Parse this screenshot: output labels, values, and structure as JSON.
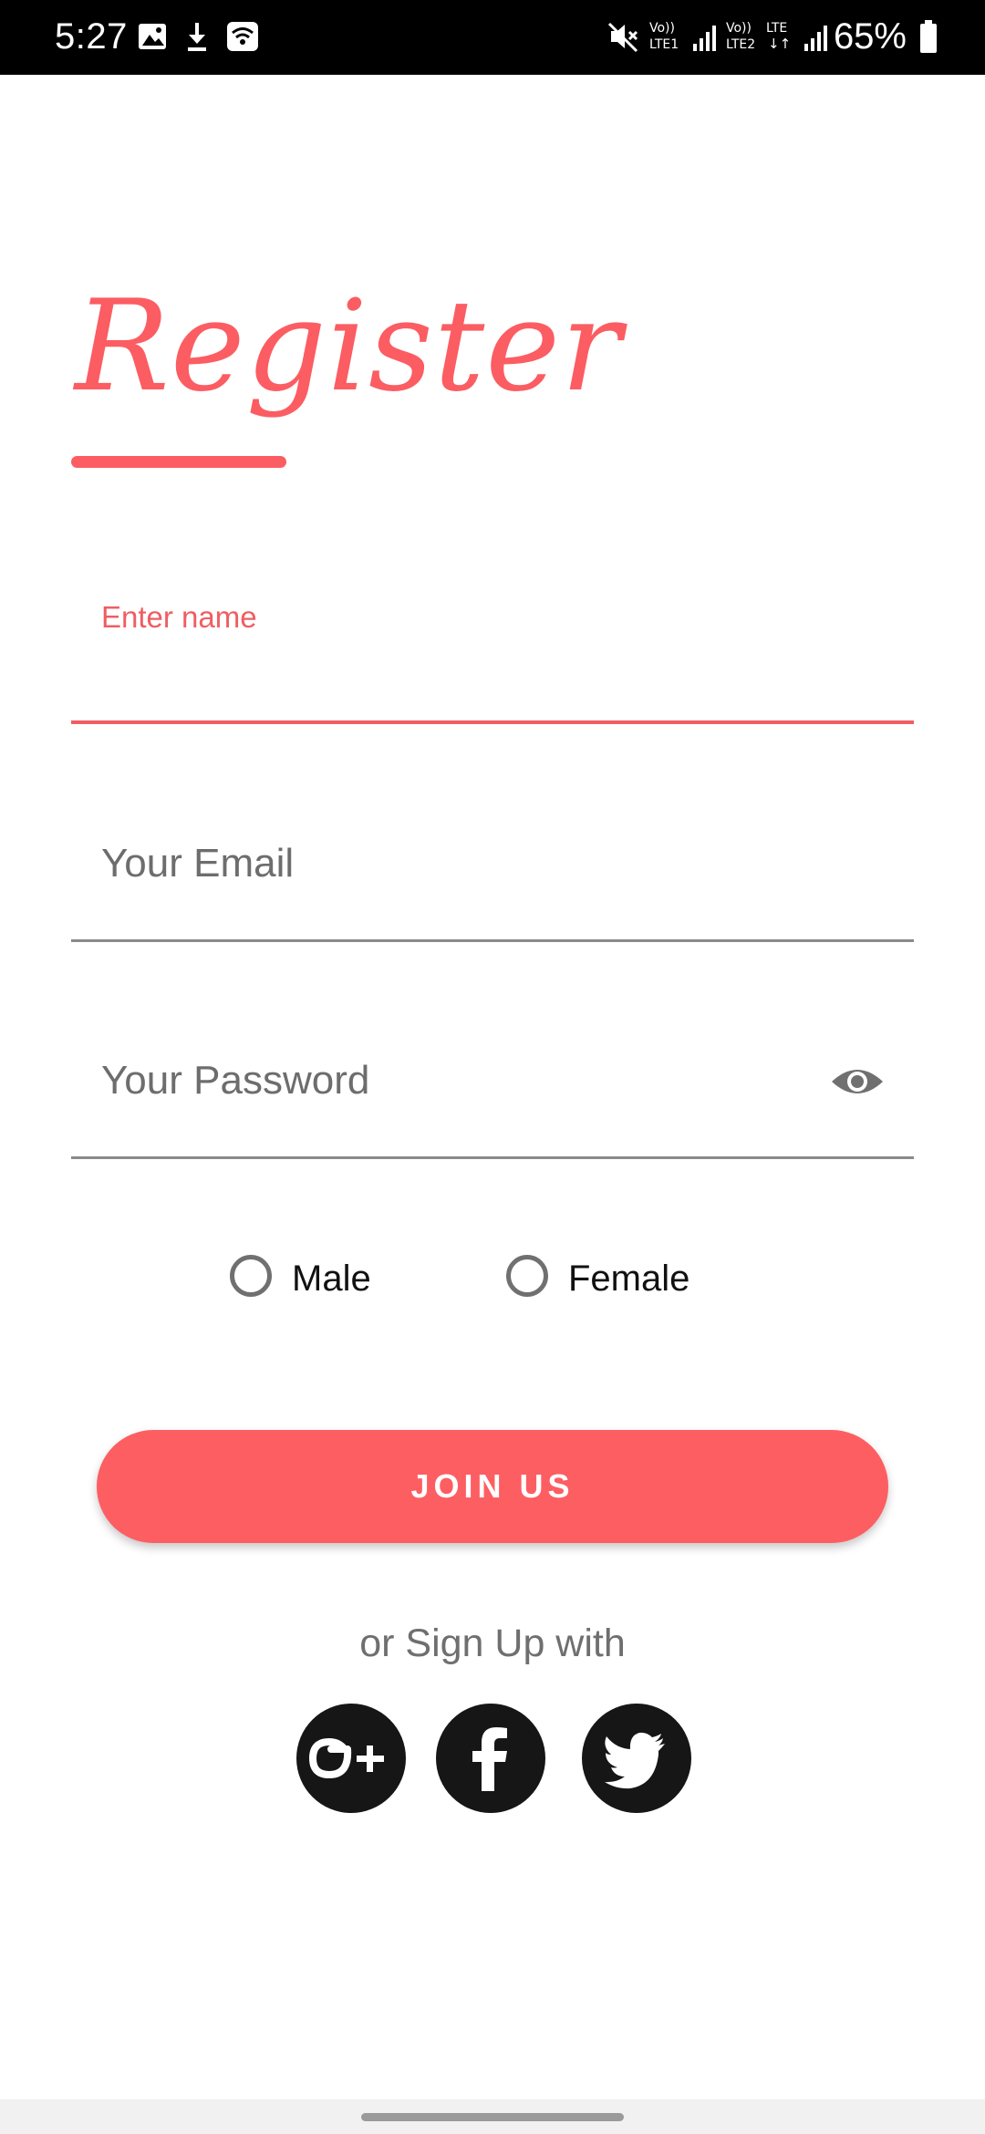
{
  "status_bar": {
    "time": "5:27",
    "battery": "65%",
    "icons": [
      "gallery-icon",
      "download-icon",
      "wifi-icon",
      "mute-icon",
      "volte-lte1-signal-icon",
      "volte-lte2-signal-icon",
      "battery-icon"
    ]
  },
  "header": {
    "title": "Register"
  },
  "form": {
    "name_label": "Enter name",
    "email_placeholder": "Your Email",
    "password_placeholder": "Your Password",
    "gender_options": [
      "Male",
      "Female"
    ]
  },
  "actions": {
    "join_label": "JOIN US",
    "or_signup_text": "or Sign Up with",
    "social": [
      "google-plus-icon",
      "facebook-icon",
      "twitter-icon"
    ]
  },
  "colors": {
    "accent": "#fd5e62",
    "status_bar": "#000000",
    "social_circle": "#161616"
  }
}
